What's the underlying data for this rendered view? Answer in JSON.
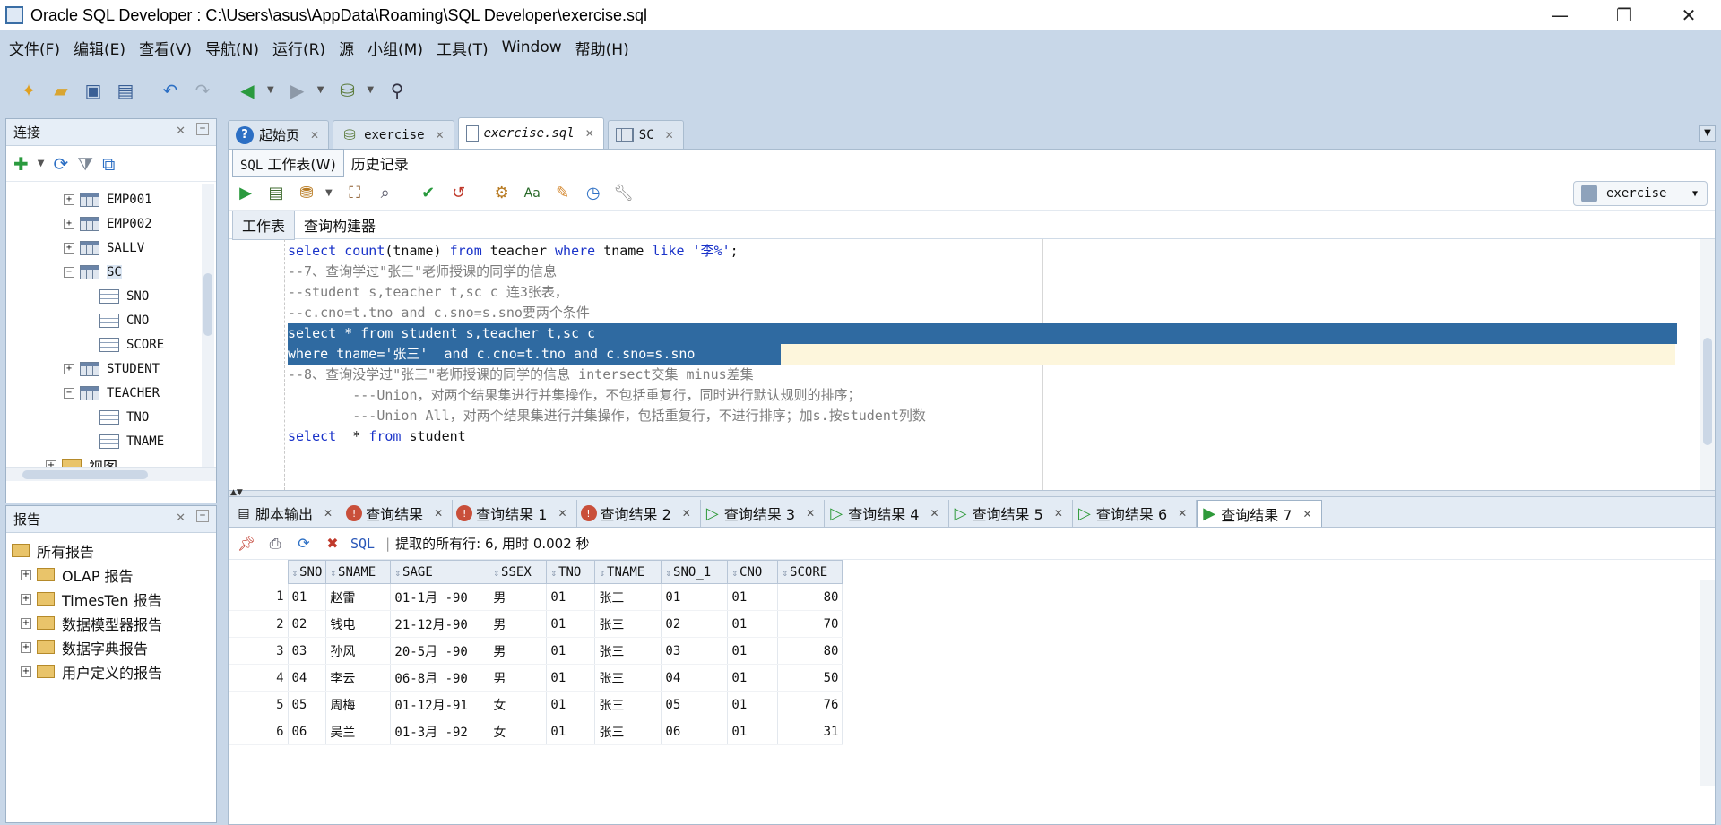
{
  "window": {
    "title": "Oracle SQL Developer : C:\\Users\\asus\\AppData\\Roaming\\SQL Developer\\exercise.sql",
    "minimize": "—",
    "maximize": "❐",
    "close": "✕"
  },
  "menu": [
    "文件(F)",
    "编辑(E)",
    "查看(V)",
    "导航(N)",
    "运行(R)",
    "源",
    "小组(M)",
    "工具(T)",
    "Window",
    "帮助(H)"
  ],
  "connections_panel": {
    "title": "连接",
    "tree": [
      {
        "label": "EMP001",
        "kind": "table",
        "level": 1,
        "expander": "+"
      },
      {
        "label": "EMP002",
        "kind": "table",
        "level": 1,
        "expander": "+"
      },
      {
        "label": "SALLV",
        "kind": "table",
        "level": 1,
        "expander": "+"
      },
      {
        "label": "SC",
        "kind": "table",
        "level": 1,
        "expander": "−"
      },
      {
        "label": "SNO",
        "kind": "column",
        "level": 2
      },
      {
        "label": "CNO",
        "kind": "column",
        "level": 2
      },
      {
        "label": "SCORE",
        "kind": "column",
        "level": 2
      },
      {
        "label": "STUDENT",
        "kind": "table",
        "level": 1,
        "expander": "+"
      },
      {
        "label": "TEACHER",
        "kind": "table",
        "level": 1,
        "expander": "−"
      },
      {
        "label": "TNO",
        "kind": "column",
        "level": 2
      },
      {
        "label": "TNAME",
        "kind": "column",
        "level": 2
      },
      {
        "label": "视图",
        "kind": "folder",
        "level": 0,
        "expander": "+"
      }
    ]
  },
  "reports_panel": {
    "title": "报告",
    "root": "所有报告",
    "items": [
      "OLAP 报告",
      "TimesTen 报告",
      "数据模型器报告",
      "数据字典报告",
      "用户定义的报告"
    ]
  },
  "doc_tabs": [
    {
      "label": "起始页",
      "icon": "help-icon"
    },
    {
      "label": "exercise",
      "icon": "sql-connection-icon"
    },
    {
      "label": "exercise.sql",
      "icon": "sql-file-icon",
      "active": true
    },
    {
      "label": "SC",
      "icon": "table-icon"
    }
  ],
  "sub_tabs": {
    "worksheet_prefix": "SQL",
    "worksheet": "工作表(W)",
    "history": "历史记录"
  },
  "connection_select": "exercise",
  "worksheet_tabs": [
    "工作表",
    "查询构建器"
  ],
  "code_lines": [
    "select count(tname) from teacher where tname like '李%';",
    "--7、查询学过\"张三\"老师授课的同学的信息",
    "--student s,teacher t,sc c 连3张表，",
    "--c.cno=t.tno and c.sno=s.sno要两个条件",
    "select * from student s,teacher t,sc c",
    "where tname='张三'  and c.cno=t.tno and c.sno=s.sno ",
    "--8、查询没学过\"张三\"老师授课的同学的信息 intersect交集 minus差集",
    "        ---Union，对两个结果集进行并集操作，不包括重复行，同时进行默认规则的排序；",
    "        ---Union All，对两个结果集进行并集操作，包括重复行，不进行排序；加s.按student列数",
    "select  * from student"
  ],
  "result_tabs": [
    {
      "label": "脚本输出",
      "icon": "script-output-icon"
    },
    {
      "label": "查询结果",
      "icon": "error-result-icon"
    },
    {
      "label": "查询结果 1",
      "icon": "error-result-icon"
    },
    {
      "label": "查询结果 2",
      "icon": "error-result-icon"
    },
    {
      "label": "查询结果 3",
      "icon": "run-icon"
    },
    {
      "label": "查询结果 4",
      "icon": "run-icon"
    },
    {
      "label": "查询结果 5",
      "icon": "run-icon"
    },
    {
      "label": "查询结果 6",
      "icon": "run-icon"
    },
    {
      "label": "查询结果 7",
      "icon": "run-icon",
      "active": true
    }
  ],
  "result_toolbar": {
    "sql_label": "SQL",
    "separator": "|",
    "status": "提取的所有行: 6, 用时 0.002 秒"
  },
  "result_grid": {
    "columns": [
      "SNO",
      "SNAME",
      "SAGE",
      "SSEX",
      "TNO",
      "TNAME",
      "SNO_1",
      "CNO",
      "SCORE"
    ],
    "rows": [
      [
        "1",
        "01",
        "赵雷",
        "01-1月 -90",
        "男",
        "01",
        "张三",
        "01",
        "01",
        "80"
      ],
      [
        "2",
        "02",
        "钱电",
        "21-12月-90",
        "男",
        "01",
        "张三",
        "02",
        "01",
        "70"
      ],
      [
        "3",
        "03",
        "孙风",
        "20-5月 -90",
        "男",
        "01",
        "张三",
        "03",
        "01",
        "80"
      ],
      [
        "4",
        "04",
        "李云",
        "06-8月 -90",
        "男",
        "01",
        "张三",
        "04",
        "01",
        "50"
      ],
      [
        "5",
        "05",
        "周梅",
        "01-12月-91",
        "女",
        "01",
        "张三",
        "05",
        "01",
        "76"
      ],
      [
        "6",
        "06",
        "吴兰",
        "01-3月 -92",
        "女",
        "01",
        "张三",
        "06",
        "01",
        "31"
      ]
    ]
  },
  "colors": {
    "selection": "#2f6aa1",
    "keyword": "#1a33c9",
    "comment": "#7d7d7d",
    "chrome": "#c8d7e8"
  }
}
